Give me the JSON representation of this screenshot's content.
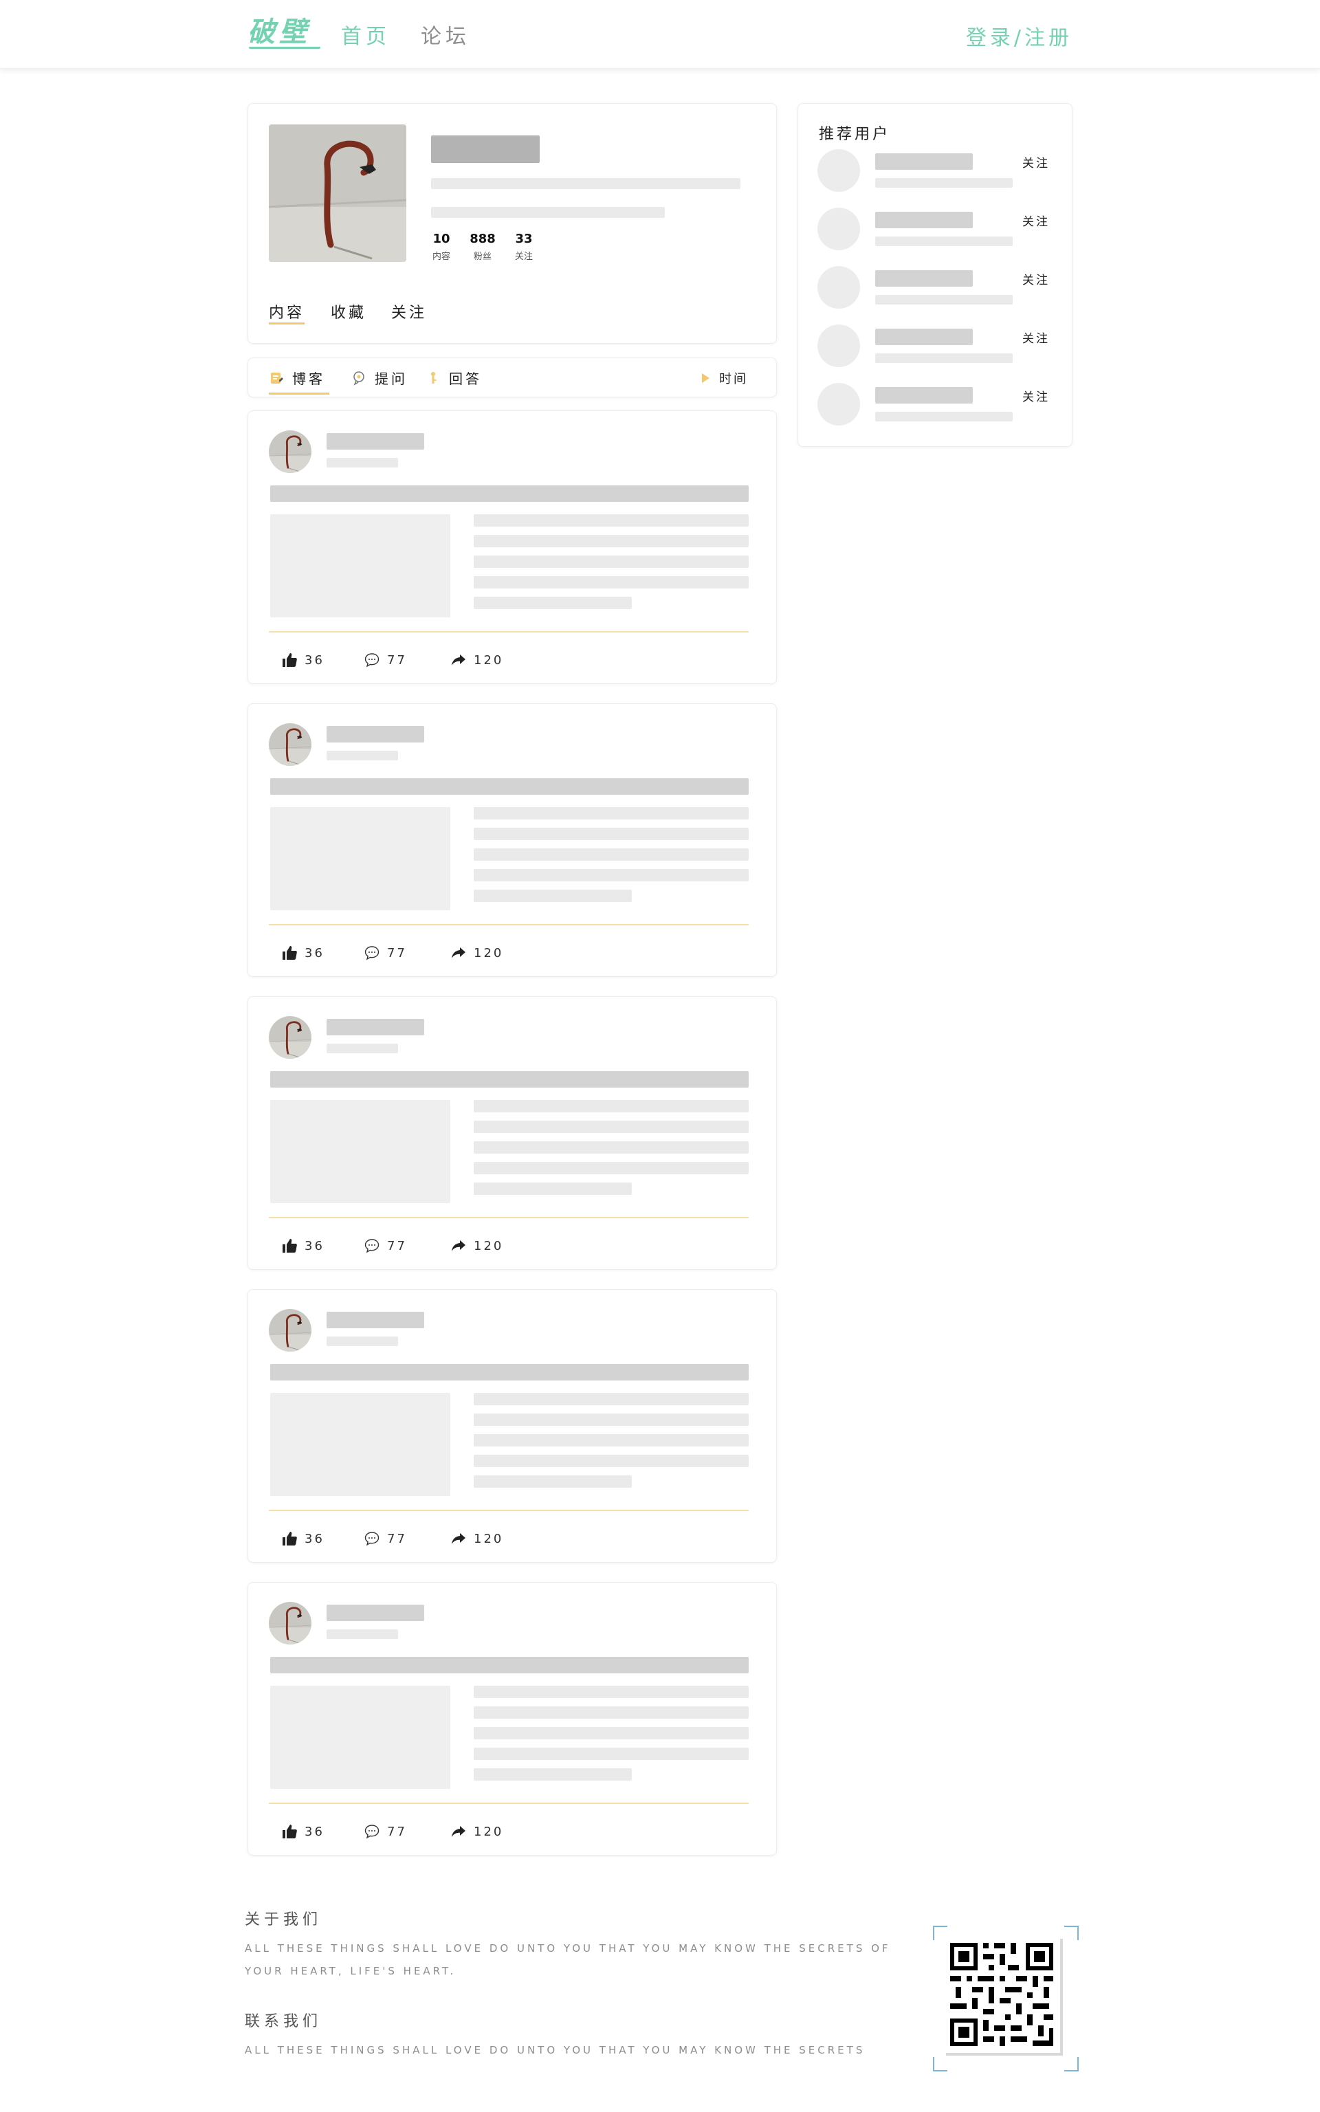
{
  "header": {
    "logo": "破壁",
    "nav": [
      {
        "label": "首页"
      },
      {
        "label": "论坛"
      }
    ],
    "login": "登录/注册",
    "accent_color": "#74d2b1"
  },
  "profile": {
    "stats": [
      {
        "value": "10",
        "label": "内容"
      },
      {
        "value": "888",
        "label": "粉丝"
      },
      {
        "value": "33",
        "label": "关注"
      }
    ],
    "tabs": [
      {
        "label": "内容"
      },
      {
        "label": "收藏"
      },
      {
        "label": "关注"
      }
    ],
    "active_tab": "内容"
  },
  "filter": {
    "tabs": [
      {
        "label": "博客",
        "icon": "blog-icon"
      },
      {
        "label": "提问",
        "icon": "question-icon"
      },
      {
        "label": "回答",
        "icon": "answer-icon"
      }
    ],
    "active_tab": "博客",
    "sort_label": "时间",
    "highlight_color": "#f4c86c"
  },
  "posts": [
    {
      "likes": "36",
      "comments": "77",
      "shares": "120"
    },
    {
      "likes": "36",
      "comments": "77",
      "shares": "120"
    },
    {
      "likes": "36",
      "comments": "77",
      "shares": "120"
    },
    {
      "likes": "36",
      "comments": "77",
      "shares": "120"
    },
    {
      "likes": "36",
      "comments": "77",
      "shares": "120"
    }
  ],
  "recommend": {
    "title": "推荐用户",
    "users": [
      {
        "follow_label": "关注"
      },
      {
        "follow_label": "关注"
      },
      {
        "follow_label": "关注"
      },
      {
        "follow_label": "关注"
      },
      {
        "follow_label": "关注"
      }
    ]
  },
  "footer": {
    "about_title": "关于我们",
    "about_text": "ALL THESE THINGS SHALL LOVE DO UNTO YOU THAT YOU MAY KNOW THE SECRETS OF YOUR HEART, LIFE'S HEART.",
    "contact_title": "联系我们",
    "contact_text": "ALL THESE THINGS SHALL LOVE DO UNTO YOU THAT YOU MAY KNOW THE SECRETS"
  }
}
